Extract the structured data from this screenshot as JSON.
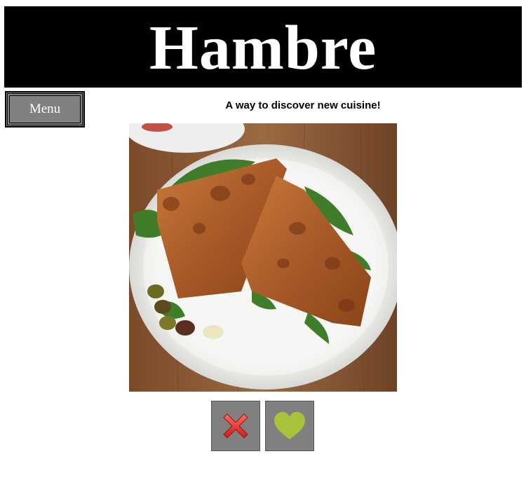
{
  "header": {
    "title": "Hambre"
  },
  "menu": {
    "label": "Menu"
  },
  "tagline": "A way to discover new cuisine!",
  "food_card": {
    "image_alt": "Focaccia sandwich with greens and olives on a white oval plate"
  },
  "actions": {
    "reject_icon": "x-icon",
    "like_icon": "heart-icon",
    "reject_color": "#e53935",
    "like_color": "#a8c23a"
  },
  "colors": {
    "header_bg": "#000000",
    "button_bg": "#808080"
  }
}
